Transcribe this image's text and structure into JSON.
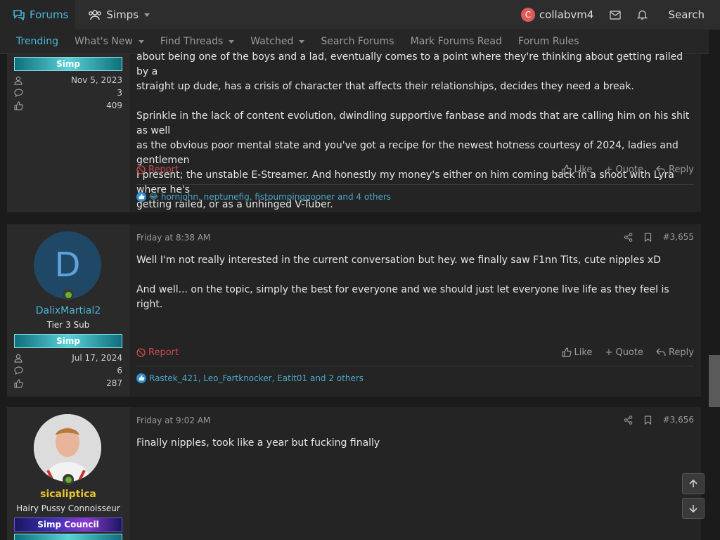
{
  "topbar": {
    "forums_label": "Forums",
    "simps_label": "Simps",
    "user_initial": "C",
    "username": "collabvm4",
    "search_label": "Search"
  },
  "subnav": {
    "items": [
      "Trending",
      "What's New",
      "Find Threads",
      "Watched",
      "Search Forums",
      "Mark Forums Read",
      "Forum Rules"
    ]
  },
  "post1": {
    "banner": "Simp",
    "joined": "Nov 5, 2023",
    "messages": "3",
    "reactions": "409",
    "lines": [
      "about being one of the boys and a lad, eventually comes to a point where they're thinking about getting railed by a",
      "straight up dude, has a crisis of character that affects their relationships, decides they need a break."
    ],
    "paragraph2": [
      "Sprinkle in the lack of content evolution, dwindling supportive fanbase and mods that are calling him on his shit as well",
      "as the obvious poor mental state and you've got a recipe for the newest hotness courtesy of 2024, ladies and gentlemen",
      "I present; the unstable E-Streamer. And honestly my money's either on him coming back in a shoot with Lyra where he's",
      "getting railed, or as a unhinged V-Tuber."
    ],
    "report": "Report",
    "like": "Like",
    "quote": "+ Quote",
    "reply": "Reply",
    "reactors": "hornjohn, neptunefig, fistpumpinggooner and 4 others"
  },
  "post2": {
    "avatar_letter": "D",
    "username": "DalixMartial2",
    "title": "Tier 3 Sub",
    "banner": "Simp",
    "joined": "Jul 17, 2024",
    "messages": "6",
    "reactions": "287",
    "date": "Friday at 8:38 AM",
    "number": "#3,655",
    "text1": "Well I'm not really interested in the current conversation but hey. we finally saw F1nn Tits, cute nipples xD",
    "text2": "And well... on the topic, simply the best for everyone and we should just let everyone live life as they feel is right.",
    "report": "Report",
    "like": "Like",
    "quote": "+ Quote",
    "reply": "Reply",
    "reactors": "Rastek_421, Leo_Fartknocker, Eatit01 and 2 others"
  },
  "post3": {
    "username": "sicaliptica",
    "title": "Hairy Pussy Connoisseur",
    "banner": "Simp Council",
    "date": "Friday at 9:02 AM",
    "number": "#3,656",
    "text1": "Finally nipples, took like a year but fucking finally"
  }
}
